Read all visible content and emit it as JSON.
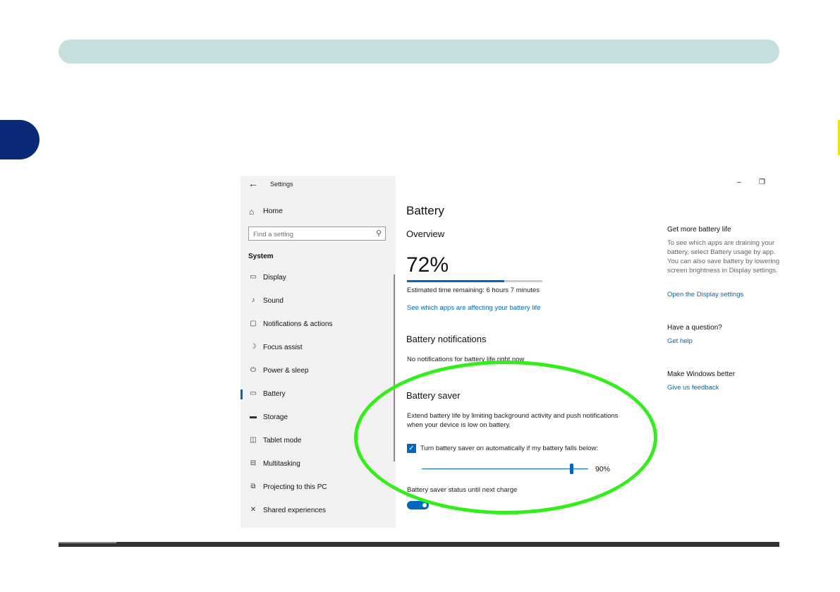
{
  "window": {
    "title": "Settings",
    "back_glyph": "←",
    "minimize_glyph": "–",
    "restore_glyph": "❐"
  },
  "sidebar": {
    "home_label": "Home",
    "search_placeholder": "Find a setting",
    "section_label": "System",
    "items": [
      {
        "label": "Display",
        "icon": "display-icon"
      },
      {
        "label": "Sound",
        "icon": "sound-icon"
      },
      {
        "label": "Notifications & actions",
        "icon": "notifications-icon"
      },
      {
        "label": "Focus assist",
        "icon": "moon-icon"
      },
      {
        "label": "Power & sleep",
        "icon": "power-icon"
      },
      {
        "label": "Battery",
        "icon": "battery-icon",
        "selected": true
      },
      {
        "label": "Storage",
        "icon": "storage-icon"
      },
      {
        "label": "Tablet mode",
        "icon": "tablet-icon"
      },
      {
        "label": "Multitasking",
        "icon": "multitasking-icon"
      },
      {
        "label": "Projecting to this PC",
        "icon": "projecting-icon"
      },
      {
        "label": "Shared experiences",
        "icon": "shared-icon"
      }
    ]
  },
  "main": {
    "page_title": "Battery",
    "overview": {
      "heading": "Overview",
      "percent_text": "72%",
      "battery_fraction": 0.72,
      "estimate": "Estimated time remaining: 6 hours 7 minutes",
      "apps_link": "See which apps are affecting your battery life"
    },
    "notifications": {
      "heading": "Battery notifications",
      "text": "No notifications for battery life right now"
    },
    "saver": {
      "heading": "Battery saver",
      "description": "Extend battery life by limiting background activity and push notifications when your device is low on battery.",
      "checkbox_label": "Turn battery saver on automatically if my battery falls below:",
      "checkbox_checked": true,
      "slider_value_text": "90%",
      "slider_fraction": 0.9,
      "status_label": "Battery saver status until next charge",
      "toggle_on": true
    }
  },
  "right_panel": {
    "more_heading": "Get more battery life",
    "more_text": "To see which apps are draining your battery, select Battery usage by app. You can also save battery by lowering screen brightness in Display settings.",
    "display_link": "Open the Display settings",
    "question_heading": "Have a question?",
    "help_link": "Get help",
    "better_heading": "Make Windows better",
    "feedback_link": "Give us feedback"
  },
  "colors": {
    "accent": "#0067c0",
    "highlight_oval": "#33ee1a",
    "doc_header": "#c6dedd",
    "chapter_tab": "#0a2a78"
  }
}
